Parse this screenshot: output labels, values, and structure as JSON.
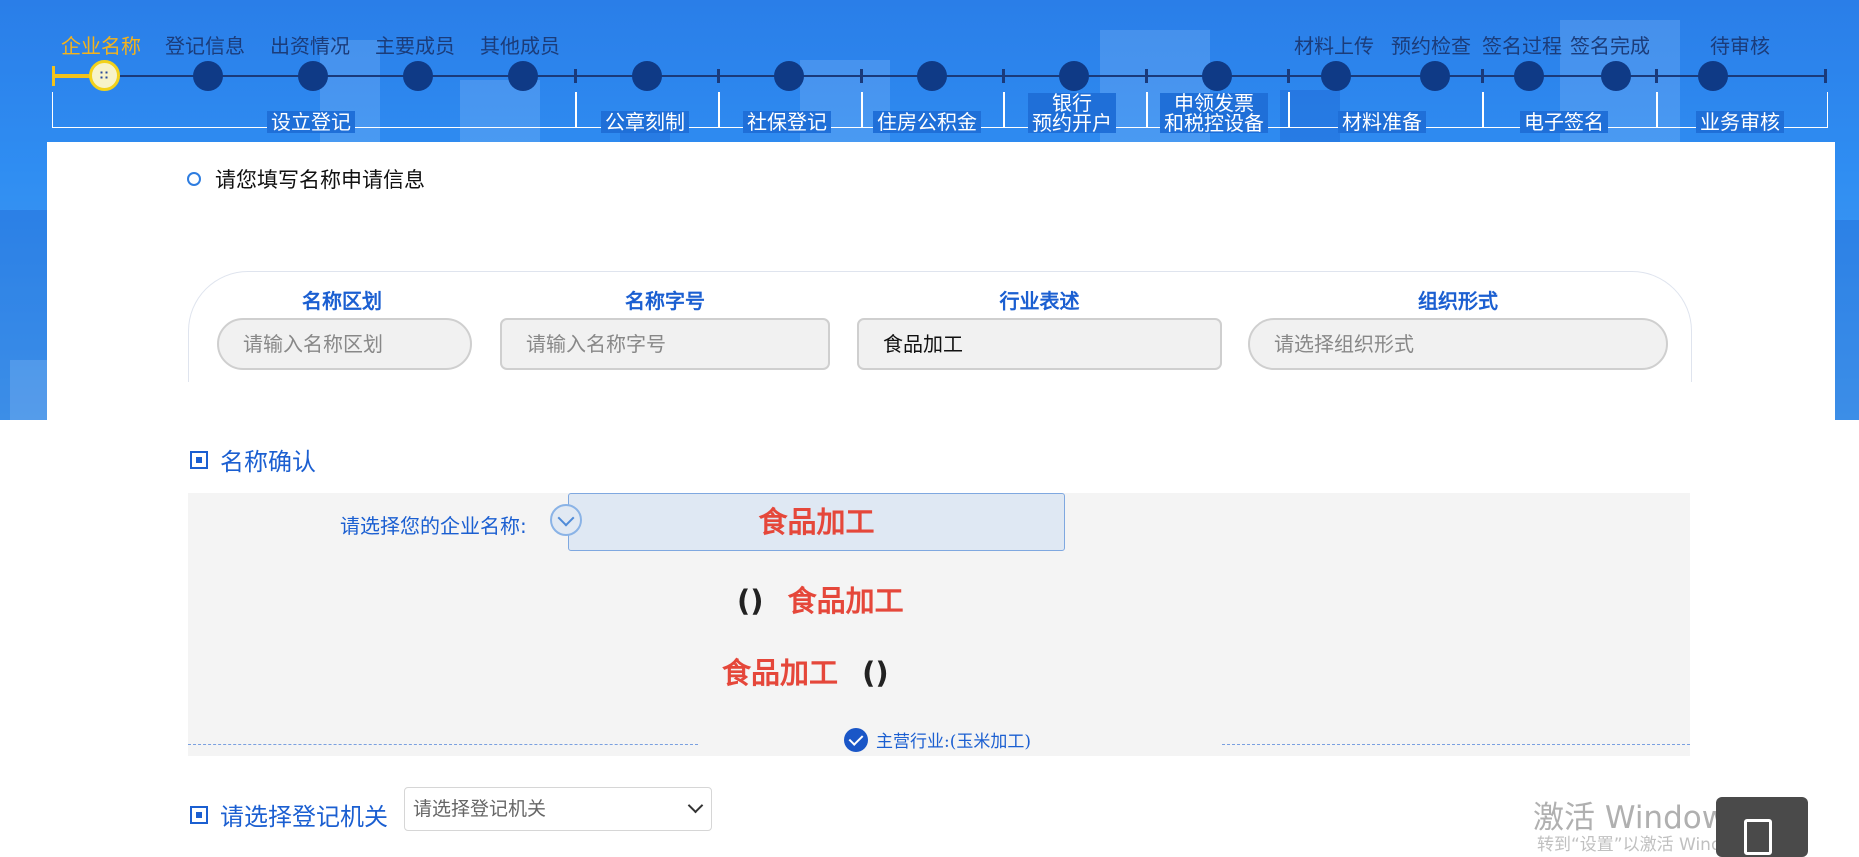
{
  "steps": [
    {
      "label": "企业名称",
      "state": "current"
    },
    {
      "label": "登记信息"
    },
    {
      "label": "出资情况"
    },
    {
      "label": "主要成员"
    },
    {
      "label": "其他成员"
    },
    {
      "label": ""
    },
    {
      "label": ""
    },
    {
      "label": ""
    },
    {
      "label": ""
    },
    {
      "label": ""
    },
    {
      "label": ""
    },
    {
      "label": "材料上传"
    },
    {
      "label": "预约检查"
    },
    {
      "label": "签名过程"
    },
    {
      "label": "签名完成"
    },
    {
      "label": "待审核"
    }
  ],
  "groups": [
    "设立登记",
    "公章刻制",
    "社保登记",
    "住房公积金",
    "银行\n预约开户",
    "申领发票\n和税控设备",
    "材料准备",
    "电子签名",
    "业务审核"
  ],
  "form": {
    "hint": "请您填写名称申请信息",
    "fields": [
      {
        "label": "名称区划",
        "placeholder": "请输入名称区划",
        "value": ""
      },
      {
        "label": "名称字号",
        "placeholder": "请输入名称字号",
        "value": ""
      },
      {
        "label": "行业表述",
        "placeholder": "",
        "value": "食品加工"
      },
      {
        "label": "组织形式",
        "placeholder": "请选择组织形式",
        "value": ""
      }
    ]
  },
  "confirm": {
    "title": "名称确认",
    "pick_label": "请选择您的企业名称:",
    "selected": "食品加工",
    "option1_prefix": "()",
    "option1_name": "食品加工",
    "option2_name": "食品加工",
    "option2_suffix": "()",
    "industry": "主营行业:(玉米加工)"
  },
  "registry": {
    "title": "请选择登记机关",
    "placeholder": "请选择登记机关"
  },
  "watermark": {
    "line1": "激活 Windows",
    "line2": "转到“设置”以激活 Windows。"
  }
}
